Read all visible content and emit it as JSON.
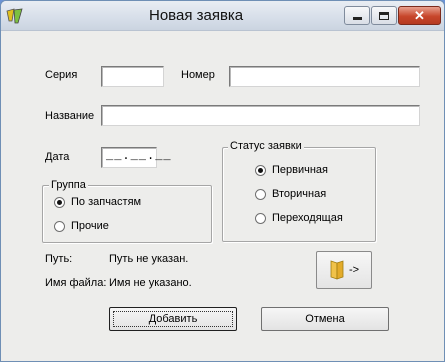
{
  "window": {
    "title": "Новая заявка",
    "close_glyph": "✕"
  },
  "form": {
    "series_label": "Серия",
    "series_value": "",
    "number_label": "Номер",
    "number_value": "",
    "name_label": "Название",
    "name_value": "",
    "date_label": "Дата",
    "date_mask": "__.__.__"
  },
  "group": {
    "title": "Группа",
    "options": [
      {
        "label": "По запчастям",
        "checked": true
      },
      {
        "label": "Прочие",
        "checked": false
      }
    ]
  },
  "status": {
    "title": "Статус заявки",
    "options": [
      {
        "label": "Первичная",
        "checked": true
      },
      {
        "label": "Вторичная",
        "checked": false
      },
      {
        "label": "Переходящая",
        "checked": false
      }
    ]
  },
  "info": {
    "path_label": "Путь:",
    "path_value": "Путь не указан.",
    "filename_label": "Имя файла:",
    "filename_value": "Имя не указано."
  },
  "browse_button": {
    "arrow_text": "->",
    "icon": "folder-icon"
  },
  "buttons": {
    "add": "Добавить",
    "cancel": "Отмена"
  },
  "colors": {
    "window_bg": "#ededeb",
    "close_button": "#c7462b"
  }
}
